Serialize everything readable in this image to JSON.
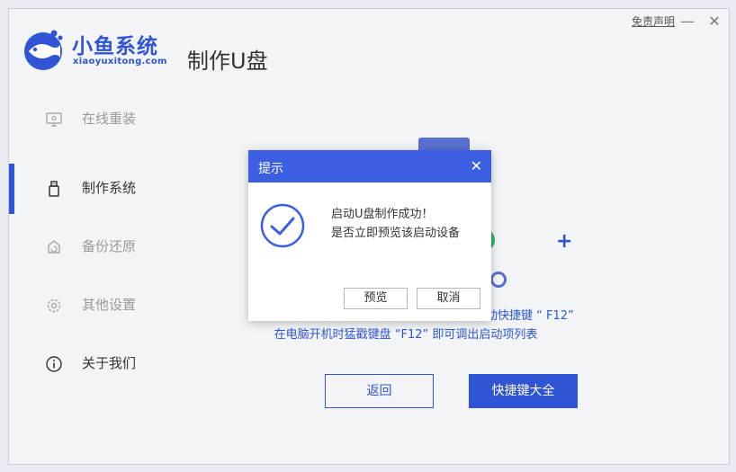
{
  "header": {
    "brand_title": "小鱼系统",
    "brand_sub": "xiaoyuxitong.com",
    "page_title": "制作U盘",
    "disclaimer": "免责声明",
    "minimize": "—",
    "close": "✕"
  },
  "sidebar": {
    "items": [
      {
        "label": "在线重装",
        "icon": "monitor-icon"
      },
      {
        "label": "制作系统",
        "icon": "usb-icon",
        "active": true
      },
      {
        "label": "备份还原",
        "icon": "backup-icon"
      },
      {
        "label": "其他设置",
        "icon": "gear-icon"
      },
      {
        "label": "关于我们",
        "icon": "info-icon"
      }
    ]
  },
  "main": {
    "hint_line1": "动快捷键 “ F12”",
    "hint_line2": "在电脑开机时猛戳键盘 “F12” 即可调出启动项列表",
    "back_button": "返回",
    "hotkeys_button": "快捷键大全"
  },
  "dialog": {
    "title": "提示",
    "close": "✕",
    "message_line1": "启动U盘制作成功！",
    "message_line2": "是否立即预览该启动设备",
    "preview_button": "预览",
    "cancel_button": "取消"
  },
  "colors": {
    "accent": "#2f55d4",
    "dialog_header": "#3b5fe0",
    "success": "#2db55d"
  }
}
